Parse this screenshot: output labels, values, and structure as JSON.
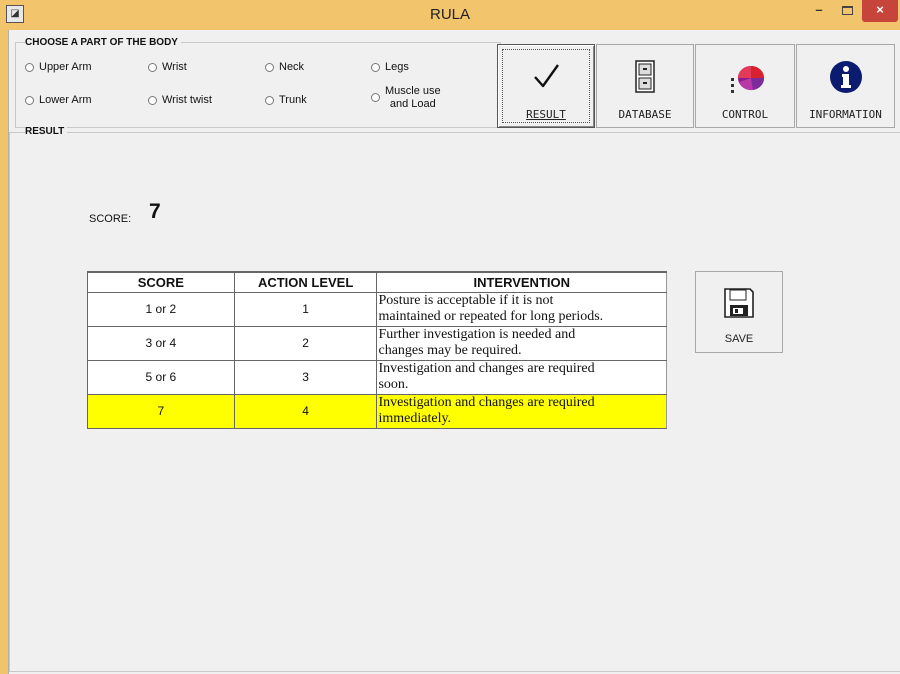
{
  "window": {
    "title": "RULA",
    "minimize_glyph": "–",
    "close_glyph": "×",
    "app_icon": "app-icon"
  },
  "body_part": {
    "legend": "CHOOSE A PART OF THE BODY",
    "options": [
      {
        "label": "Upper Arm"
      },
      {
        "label": "Wrist"
      },
      {
        "label": "Neck"
      },
      {
        "label": "Legs"
      },
      {
        "label": "Lower Arm"
      },
      {
        "label": "Wrist twist"
      },
      {
        "label": "Trunk"
      },
      {
        "label_line1": "Muscle use",
        "label_line2": "and Load"
      }
    ]
  },
  "toolbar": {
    "buttons": [
      {
        "label": "RESULT",
        "icon": "checkmark-icon"
      },
      {
        "label": "DATABASE",
        "icon": "filing-cabinet-icon"
      },
      {
        "label": "CONTROL",
        "icon": "pie-chart-icon"
      },
      {
        "label": "INFORMATION",
        "icon": "info-icon"
      }
    ]
  },
  "result": {
    "legend": "RESULT",
    "score_label": "SCORE:",
    "score_value": "7",
    "table": {
      "headers": [
        "SCORE",
        "ACTION LEVEL",
        "INTERVENTION"
      ],
      "rows": [
        {
          "score": "1 or 2",
          "level": "1",
          "intervention_1": "Posture is acceptable if it is not",
          "intervention_2": "maintained or repeated for long periods."
        },
        {
          "score": "3 or 4",
          "level": "2",
          "intervention_1": "Further investigation is needed and",
          "intervention_2": "changes may be required."
        },
        {
          "score": "5 or 6",
          "level": "3",
          "intervention_1": "Investigation and changes are required",
          "intervention_2": "soon."
        },
        {
          "score": "7",
          "level": "4",
          "intervention_1": "Investigation and changes are required",
          "intervention_2": "immediately.",
          "highlight": true
        }
      ]
    },
    "save_label": "SAVE",
    "save_icon": "floppy-disk-icon",
    "highlight_color": "#ffff00"
  }
}
